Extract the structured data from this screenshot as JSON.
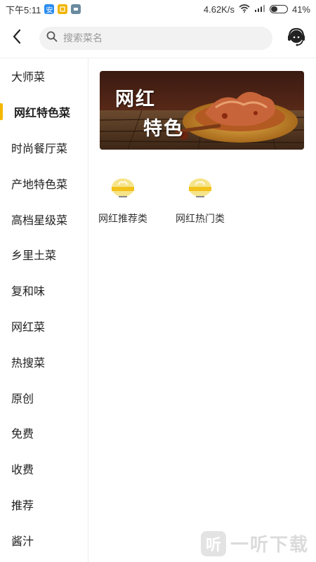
{
  "status_bar": {
    "time": "下午5:11",
    "app_icons": [
      {
        "name": "security-app-icon",
        "color": "#2a8cf0",
        "glyph": "安"
      },
      {
        "name": "notes-app-icon",
        "color": "#f0b400",
        "glyph": ""
      },
      {
        "name": "gallery-app-icon",
        "color": "#6a8aa0",
        "glyph": ""
      }
    ],
    "network_speed": "4.62K/s",
    "battery": "41%",
    "battery_level": 0.41
  },
  "header": {
    "search_placeholder": "搜索菜名"
  },
  "sidebar": {
    "items": [
      {
        "label": "大师菜",
        "active": false
      },
      {
        "label": "网红特色菜",
        "active": true
      },
      {
        "label": "时尚餐厅菜",
        "active": false
      },
      {
        "label": "产地特色菜",
        "active": false
      },
      {
        "label": "高档星级菜",
        "active": false
      },
      {
        "label": "乡里土菜",
        "active": false
      },
      {
        "label": "复和味",
        "active": false
      },
      {
        "label": "网红菜",
        "active": false
      },
      {
        "label": "热搜菜",
        "active": false
      },
      {
        "label": "原创",
        "active": false
      },
      {
        "label": "免费",
        "active": false
      },
      {
        "label": "收费",
        "active": false
      },
      {
        "label": "推荐",
        "active": false
      },
      {
        "label": "酱汁",
        "active": false
      }
    ]
  },
  "main": {
    "banner": {
      "line1": "网红",
      "line2": "特色"
    },
    "categories": [
      {
        "label": "网红推荐类"
      },
      {
        "label": "网红热门类"
      }
    ]
  },
  "watermark": {
    "icon_glyph": "听",
    "text": "一听下载"
  },
  "colors": {
    "accent": "#f5b800",
    "text": "#222222",
    "search_bg": "#f2f2f2"
  }
}
